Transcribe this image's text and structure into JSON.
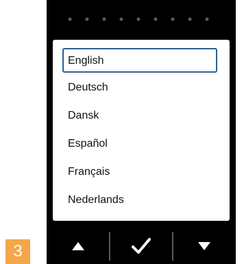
{
  "step_badge": "3",
  "languages": [
    {
      "label": "English",
      "selected": true
    },
    {
      "label": "Deutsch",
      "selected": false
    },
    {
      "label": "Dansk",
      "selected": false
    },
    {
      "label": "Español",
      "selected": false
    },
    {
      "label": "Français",
      "selected": false
    },
    {
      "label": "Nederlands",
      "selected": false
    }
  ],
  "buttons": {
    "up": {
      "icon": "triangle-up-icon"
    },
    "confirm": {
      "icon": "checkmark-icon"
    },
    "down": {
      "icon": "triangle-down-icon"
    }
  },
  "page_indicator": {
    "count": 9
  },
  "colors": {
    "device_bg": "#000000",
    "list_bg": "#ffffff",
    "selection_border": "#2c5f8c",
    "badge_bg": "#f4a64a",
    "dot_color": "#5c5c5c"
  }
}
